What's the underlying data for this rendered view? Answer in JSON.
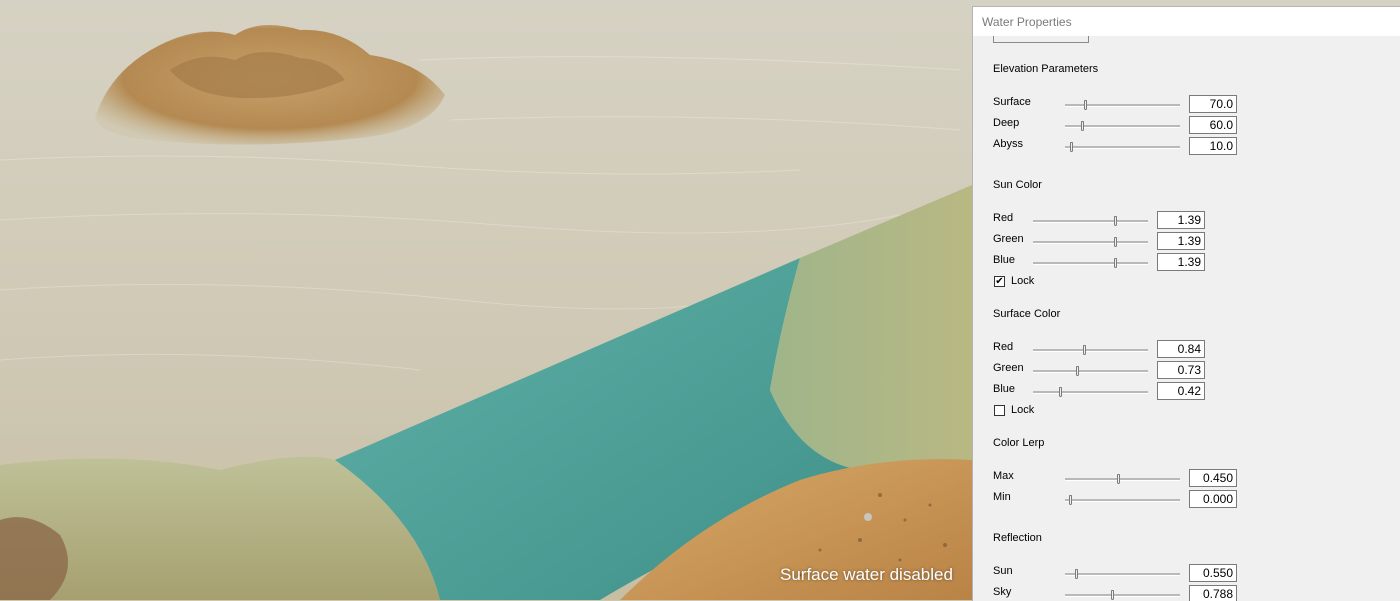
{
  "viewport": {
    "overlay_text": "Surface water disabled",
    "colors": {
      "water_surface": "#d9d4c2",
      "water_clear": "#4ea39b",
      "terrain_sand": "#c49a5c",
      "terrain_grass": "#b8b98a"
    }
  },
  "panel": {
    "title": "Water Properties",
    "elevation": {
      "heading": "Elevation Parameters",
      "rows": [
        {
          "label": "Surface",
          "value": "70.0",
          "slider_fraction": 0.18
        },
        {
          "label": "Deep",
          "value": "60.0",
          "slider_fraction": 0.16
        },
        {
          "label": "Abyss",
          "value": "10.0",
          "slider_fraction": 0.06
        }
      ]
    },
    "sun_color": {
      "heading": "Sun Color",
      "rows": [
        {
          "label": "Red",
          "value": "1.39",
          "slider_fraction": 0.72
        },
        {
          "label": "Green",
          "value": "1.39",
          "slider_fraction": 0.72
        },
        {
          "label": "Blue",
          "value": "1.39",
          "slider_fraction": 0.72
        }
      ],
      "lock_label": "Lock",
      "lock_checked": true
    },
    "surface_color": {
      "heading": "Surface Color",
      "rows": [
        {
          "label": "Red",
          "value": "0.84",
          "slider_fraction": 0.45
        },
        {
          "label": "Green",
          "value": "0.73",
          "slider_fraction": 0.39
        },
        {
          "label": "Blue",
          "value": "0.42",
          "slider_fraction": 0.24
        }
      ],
      "lock_label": "Lock",
      "lock_checked": false
    },
    "color_lerp": {
      "heading": "Color Lerp",
      "rows": [
        {
          "label": "Max",
          "value": "0.450",
          "slider_fraction": 0.47
        },
        {
          "label": "Min",
          "value": "0.000",
          "slider_fraction": 0.05
        }
      ]
    },
    "reflection": {
      "heading": "Reflection",
      "rows": [
        {
          "label": "Sun",
          "value": "0.550",
          "slider_fraction": 0.1
        },
        {
          "label": "Sky",
          "value": "0.788",
          "slider_fraction": 0.42
        }
      ]
    }
  }
}
